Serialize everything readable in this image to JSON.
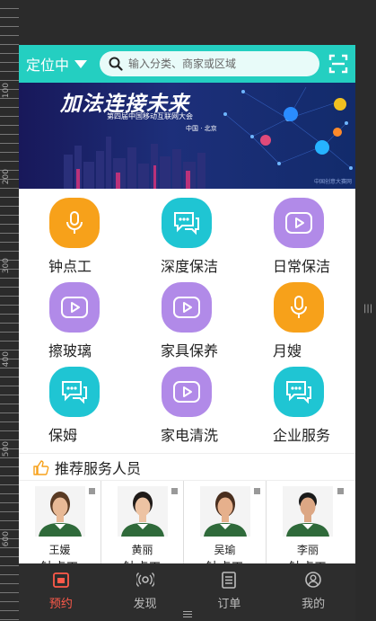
{
  "header": {
    "location_label": "定位中",
    "search_placeholder": "输入分类、商家或区域"
  },
  "banner": {
    "headline": "加法连接未来",
    "subtitle": "第四届中国移动互联网大会",
    "city": "中国 · 北京",
    "credit": "中国创意大赛网"
  },
  "services": [
    {
      "label": "钟点工",
      "icon": "microphone-icon",
      "color": "#f7a11a"
    },
    {
      "label": "深度保洁",
      "icon": "chat-bubbles-icon",
      "color": "#1fc5d3"
    },
    {
      "label": "日常保洁",
      "icon": "play-icon",
      "color": "#b18ae8"
    },
    {
      "label": "擦玻璃",
      "icon": "play-icon",
      "color": "#b18ae8"
    },
    {
      "label": "家具保养",
      "icon": "play-icon",
      "color": "#b18ae8"
    },
    {
      "label": "月嫂",
      "icon": "microphone-icon",
      "color": "#f7a11a"
    },
    {
      "label": "保姆",
      "icon": "chat-bubbles-icon",
      "color": "#1fc5d3"
    },
    {
      "label": "家电清洗",
      "icon": "play-icon",
      "color": "#b18ae8"
    },
    {
      "label": "企业服务",
      "icon": "chat-bubbles-icon",
      "color": "#1fc5d3"
    }
  ],
  "recommend": {
    "title": "推荐服务人员",
    "staff": [
      {
        "name": "王媛",
        "role": "钟点工"
      },
      {
        "name": "黄丽",
        "role": "钟点工"
      },
      {
        "name": "吴瑜",
        "role": "钟点工"
      },
      {
        "name": "李丽",
        "role": "钟点工"
      }
    ]
  },
  "tabs": [
    {
      "label": "预约",
      "icon": "calendar-icon",
      "active": true
    },
    {
      "label": "发现",
      "icon": "broadcast-icon",
      "active": false
    },
    {
      "label": "订单",
      "icon": "list-icon",
      "active": false
    },
    {
      "label": "我的",
      "icon": "user-icon",
      "active": false
    }
  ],
  "ruler": {
    "marks": [
      "100",
      "200",
      "300",
      "400",
      "500",
      "600"
    ]
  },
  "colors": {
    "accent": "#24cfc1",
    "active_tab": "#ff5a4a",
    "tabbar": "#2d2d2d"
  }
}
